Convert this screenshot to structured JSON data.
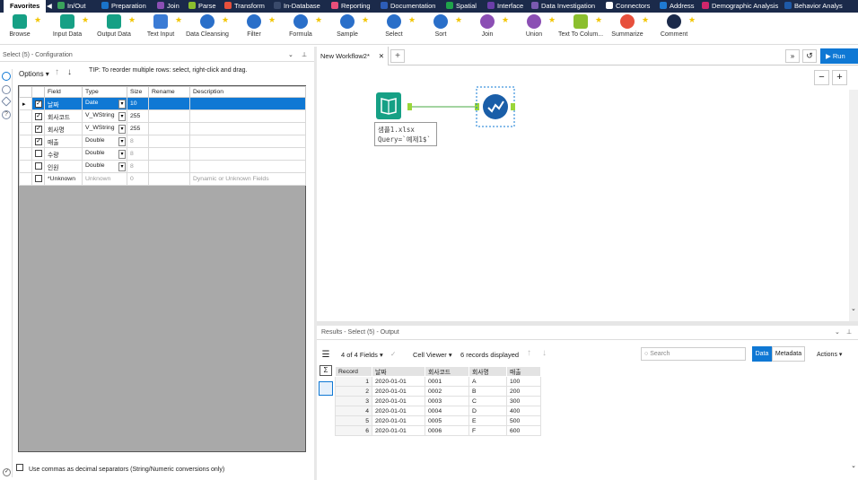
{
  "categories": [
    {
      "label": "Favorites",
      "active": true,
      "color": "#ffffff"
    },
    {
      "label": "In/Out",
      "color": "#3aa35b"
    },
    {
      "label": "Preparation",
      "color": "#1a73c9"
    },
    {
      "label": "Join",
      "color": "#8b4fb4"
    },
    {
      "label": "Parse",
      "color": "#8bbf2e"
    },
    {
      "label": "Transform",
      "color": "#e7503c"
    },
    {
      "label": "In-Database",
      "color": "#3a4a6b"
    },
    {
      "label": "Reporting",
      "color": "#e94f7a"
    },
    {
      "label": "Documentation",
      "color": "#2d5db8"
    },
    {
      "label": "Spatial",
      "color": "#1fa34a"
    },
    {
      "label": "Interface",
      "color": "#6b3ea8"
    },
    {
      "label": "Data Investigation",
      "color": "#7a5ab0"
    },
    {
      "label": "Connectors",
      "color": "#ffffff"
    },
    {
      "label": "Address",
      "color": "#1f7ad1"
    },
    {
      "label": "Demographic Analysis",
      "color": "#d1266b"
    },
    {
      "label": "Behavior Analys",
      "color": "#1e5aa8"
    }
  ],
  "tools": [
    {
      "label": "Browse",
      "color": "#16a085"
    },
    {
      "label": "Input Data",
      "color": "#16a085"
    },
    {
      "label": "Output Data",
      "color": "#16a085"
    },
    {
      "label": "Text Input",
      "color": "#3a7bd5"
    },
    {
      "label": "Data Cleansing",
      "color": "#2a6fc9"
    },
    {
      "label": "Filter",
      "color": "#2a6fc9"
    },
    {
      "label": "Formula",
      "color": "#2a6fc9"
    },
    {
      "label": "Sample",
      "color": "#2a6fc9"
    },
    {
      "label": "Select",
      "color": "#2a6fc9"
    },
    {
      "label": "Sort",
      "color": "#2a6fc9"
    },
    {
      "label": "Join",
      "color": "#8b4fb4"
    },
    {
      "label": "Union",
      "color": "#8b4fb4"
    },
    {
      "label": "Text To Colum...",
      "color": "#8bbf2e"
    },
    {
      "label": "Summarize",
      "color": "#e7503c"
    },
    {
      "label": "Comment",
      "color": "#1b2a4a"
    }
  ],
  "config": {
    "title": "Select (5) - Configuration",
    "options_label": "Options",
    "tip": "TIP: To reorder multiple rows: select, right-click and drag.",
    "headers": [
      "Field",
      "Type",
      "Size",
      "Rename",
      "Description"
    ],
    "rows": [
      {
        "checked": true,
        "field": "날짜",
        "type": "Date",
        "size": "10",
        "rename": "",
        "desc": "",
        "selected": true
      },
      {
        "checked": true,
        "field": "회사코드",
        "type": "V_WString",
        "size": "255",
        "rename": "",
        "desc": ""
      },
      {
        "checked": true,
        "field": "회사명",
        "type": "V_WString",
        "size": "255",
        "rename": "",
        "desc": ""
      },
      {
        "checked": true,
        "field": "매출",
        "type": "Double",
        "size": "8",
        "rename": "",
        "desc": ""
      },
      {
        "checked": false,
        "field": "수량",
        "type": "Double",
        "size": "8",
        "rename": "",
        "desc": ""
      },
      {
        "checked": false,
        "field": "인원",
        "type": "Double",
        "size": "8",
        "rename": "",
        "desc": ""
      },
      {
        "checked": false,
        "field": "*Unknown",
        "type": "Unknown",
        "size": "0",
        "rename": "",
        "desc": "Dynamic or Unknown Fields"
      }
    ],
    "commas_label": "Use commas as decimal separators (String/Numeric conversions only)"
  },
  "workflow": {
    "tab": "New Workflow2*",
    "run_label": "Run",
    "input_caption_1": "샘플1.xlsx",
    "input_caption_2": "Query=`예제1$`"
  },
  "results": {
    "title": "Results - Select (5) - Output",
    "fields": "4 of 4 Fields",
    "viewer": "Cell Viewer",
    "records": "6 records displayed",
    "search_placeholder": "Search",
    "data_btn": "Data",
    "metadata_btn": "Metadata",
    "actions": "Actions",
    "headers": [
      "Record",
      "날짜",
      "회사코드",
      "회사명",
      "매출"
    ],
    "rows": [
      [
        "1",
        "2020-01-01",
        "0001",
        "A",
        "100"
      ],
      [
        "2",
        "2020-01-01",
        "0002",
        "B",
        "200"
      ],
      [
        "3",
        "2020-01-01",
        "0003",
        "C",
        "300"
      ],
      [
        "4",
        "2020-01-01",
        "0004",
        "D",
        "400"
      ],
      [
        "5",
        "2020-01-01",
        "0005",
        "E",
        "500"
      ],
      [
        "6",
        "2020-01-01",
        "0006",
        "F",
        "600"
      ]
    ]
  }
}
